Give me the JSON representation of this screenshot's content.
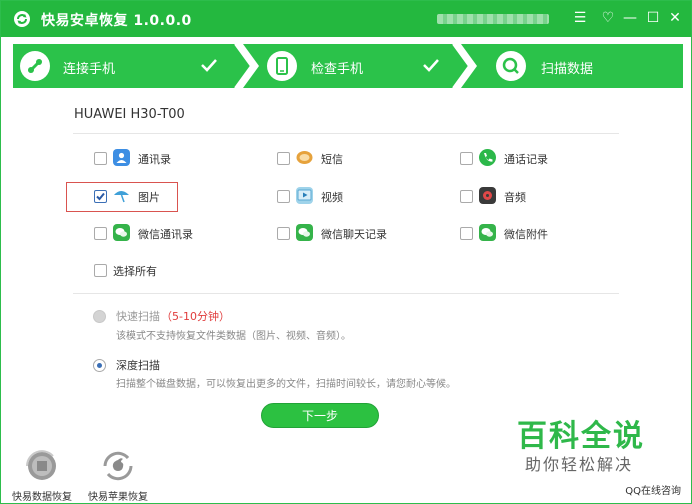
{
  "app": {
    "title": "快易安卓恢复  1.0.0.0"
  },
  "window_controls": {
    "menu": "☰",
    "skin": "♡",
    "minimize": "—",
    "maximize": "☐",
    "close": "✕"
  },
  "steps": [
    {
      "label": "连接手机",
      "icon": "phone-connect-icon",
      "done": true
    },
    {
      "label": "检查手机",
      "icon": "phone-icon",
      "done": true
    },
    {
      "label": "扫描数据",
      "icon": "search-icon",
      "done": false
    }
  ],
  "device": {
    "name": "HUAWEI H30-T00"
  },
  "data_types": [
    {
      "label": "通讯录",
      "icon": "contacts-icon",
      "checked": false
    },
    {
      "label": "短信",
      "icon": "sms-icon",
      "checked": false
    },
    {
      "label": "通话记录",
      "icon": "call-log-icon",
      "checked": false
    },
    {
      "label": "图片",
      "icon": "picture-icon",
      "checked": true
    },
    {
      "label": "视频",
      "icon": "video-icon",
      "checked": false
    },
    {
      "label": "音频",
      "icon": "audio-icon",
      "checked": false
    },
    {
      "label": "微信通讯录",
      "icon": "wechat-contacts-icon",
      "checked": false
    },
    {
      "label": "微信聊天记录",
      "icon": "wechat-chat-icon",
      "checked": false
    },
    {
      "label": "微信附件",
      "icon": "wechat-attachment-icon",
      "checked": false
    }
  ],
  "select_all": {
    "label": "选择所有"
  },
  "scan_modes": {
    "quick": {
      "title": "快速扫描",
      "duration": "（5-10分钟）",
      "desc": "该模式不支持恢复文件类数据（图片、视频、音频）。",
      "enabled": false
    },
    "deep": {
      "title": "深度扫描",
      "desc": "扫描整个磁盘数据，可以恢复出更多的文件，扫描时间较长，请您耐心等候。",
      "selected": true
    }
  },
  "next_button": {
    "label": "下一步"
  },
  "bottom_apps": [
    {
      "label": "快易数据恢复",
      "icon": "data-recovery-icon"
    },
    {
      "label": "快易苹果恢复",
      "icon": "apple-recovery-icon"
    }
  ],
  "qq_link": "QQ在线咨询",
  "watermark": {
    "title": "百科全说",
    "subtitle": "助你轻松解决"
  },
  "colors": {
    "primary_green": "#24b83f",
    "step_green": "#2bc24a",
    "checkbox_blue": "#3b6fb6",
    "highlight_red": "#d9534f",
    "duration_red": "#e03c3c"
  }
}
